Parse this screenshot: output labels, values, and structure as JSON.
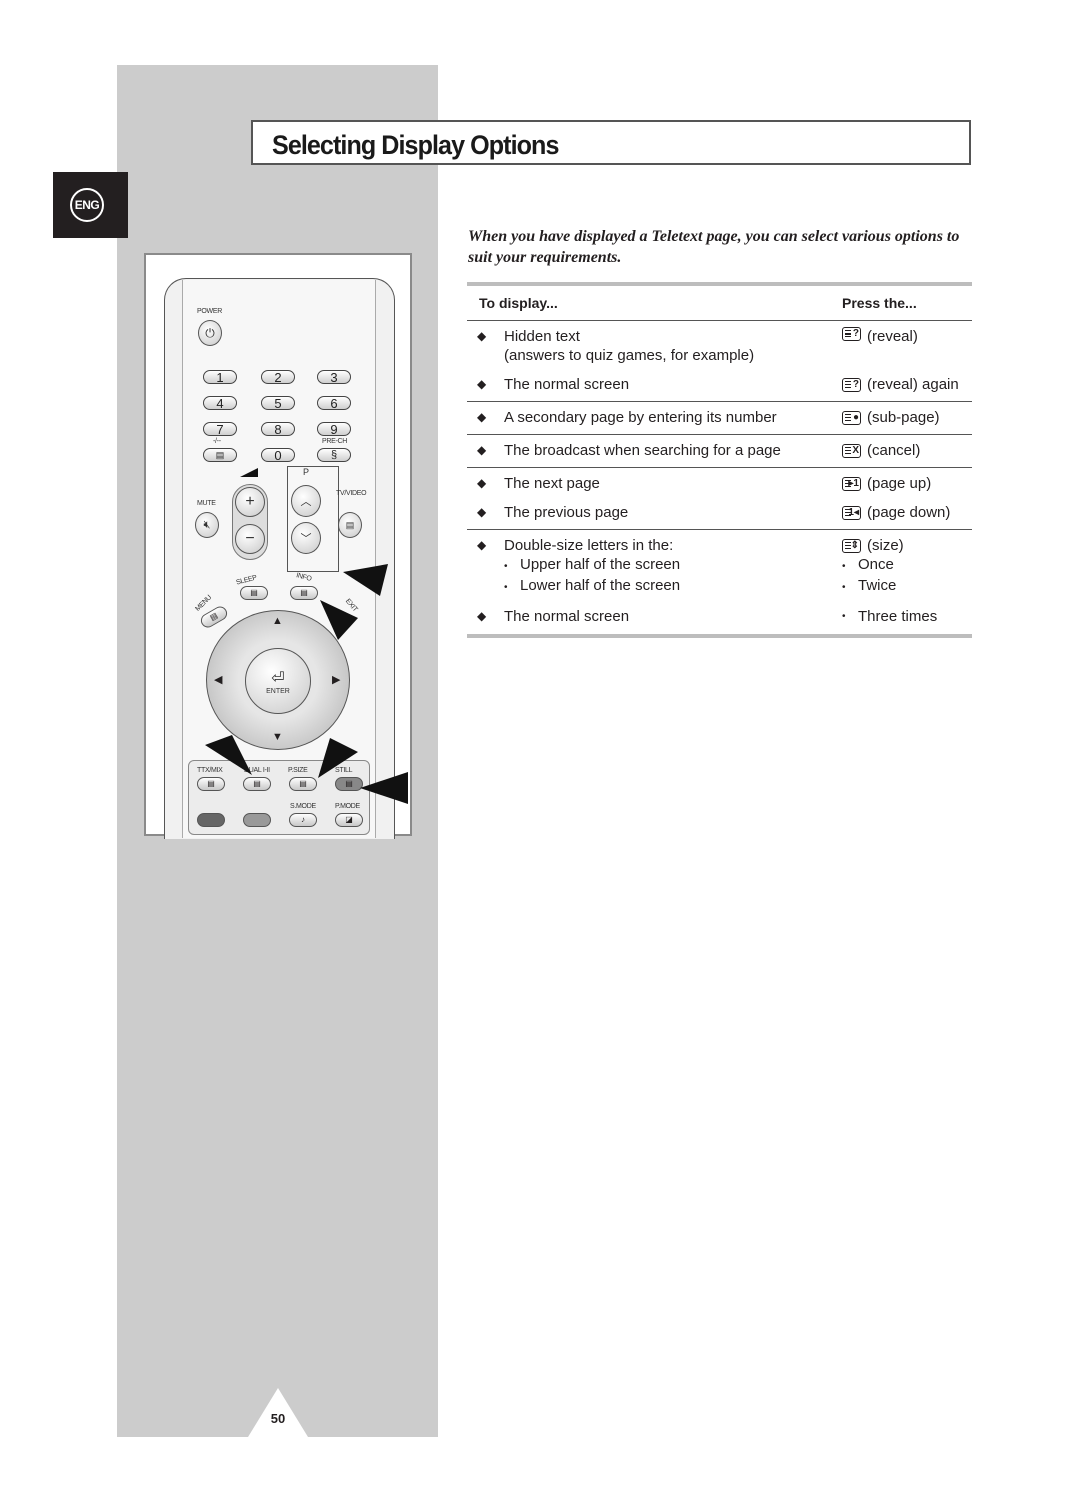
{
  "page": {
    "title": "Selecting Display Options",
    "language_tab": "ENG",
    "page_number": "50",
    "intro": "When you have displayed a Teletext page, you can select various options to suit your requirements."
  },
  "table": {
    "header": {
      "col1": "To display...",
      "col2": "Press the..."
    },
    "groups": [
      {
        "rows": [
          {
            "bullet": "◆",
            "desc": "Hidden text",
            "desc2": "(answers to quiz games, for example)",
            "icon": "reveal-icon",
            "icon_glyph": "?",
            "press": "(reveal)"
          },
          {
            "bullet": "◆",
            "desc": "The normal screen",
            "icon": "reveal-icon",
            "icon_glyph": "?",
            "press": "(reveal) again"
          }
        ]
      },
      {
        "rows": [
          {
            "bullet": "◆",
            "desc": "A secondary page by entering its number",
            "icon": "sub-page-icon",
            "icon_glyph": "●",
            "press": "(sub-page)"
          }
        ]
      },
      {
        "rows": [
          {
            "bullet": "◆",
            "desc": "The broadcast when searching for a page",
            "icon": "cancel-icon",
            "icon_glyph": "X",
            "press": "(cancel)"
          }
        ]
      },
      {
        "rows": [
          {
            "bullet": "◆",
            "desc": "The next page",
            "icon": "page-up-icon",
            "icon_glyph": "▸1",
            "press": "(page up)"
          },
          {
            "bullet": "◆",
            "desc": "The previous page",
            "icon": "page-down-icon",
            "icon_glyph": "1◂",
            "press": "(page down)"
          }
        ]
      },
      {
        "rows": [
          {
            "bullet": "◆",
            "desc": "Double-size letters in the:",
            "icon": "size-icon",
            "icon_glyph": "⇕",
            "press": "(size)",
            "subs": [
              {
                "desc": "Upper half of the screen",
                "press": "Once"
              },
              {
                "desc": "Lower half of the screen",
                "press": "Twice"
              }
            ]
          },
          {
            "bullet": "◆",
            "desc": "The normal screen",
            "press_sub": "Three times"
          }
        ]
      }
    ]
  },
  "remote": {
    "labels": {
      "power": "POWER",
      "dash": "-/--",
      "prech": "PRE-CH",
      "p": "P",
      "mute": "MUTE",
      "tvvideo": "TV/VIDEO",
      "sleep": "SLEEP",
      "info": "INFO",
      "menu": "MENU",
      "exit": "EXIT",
      "enter": "ENTER",
      "ttxmix": "TTX/MIX",
      "dualhi": "DUAL I-II",
      "psize": "P.SIZE",
      "still": "STILL",
      "smode": "S.MODE",
      "pmode": "P.MODE"
    },
    "number_keys": [
      "1",
      "2",
      "3",
      "4",
      "5",
      "6",
      "7",
      "8",
      "9",
      "0"
    ]
  }
}
